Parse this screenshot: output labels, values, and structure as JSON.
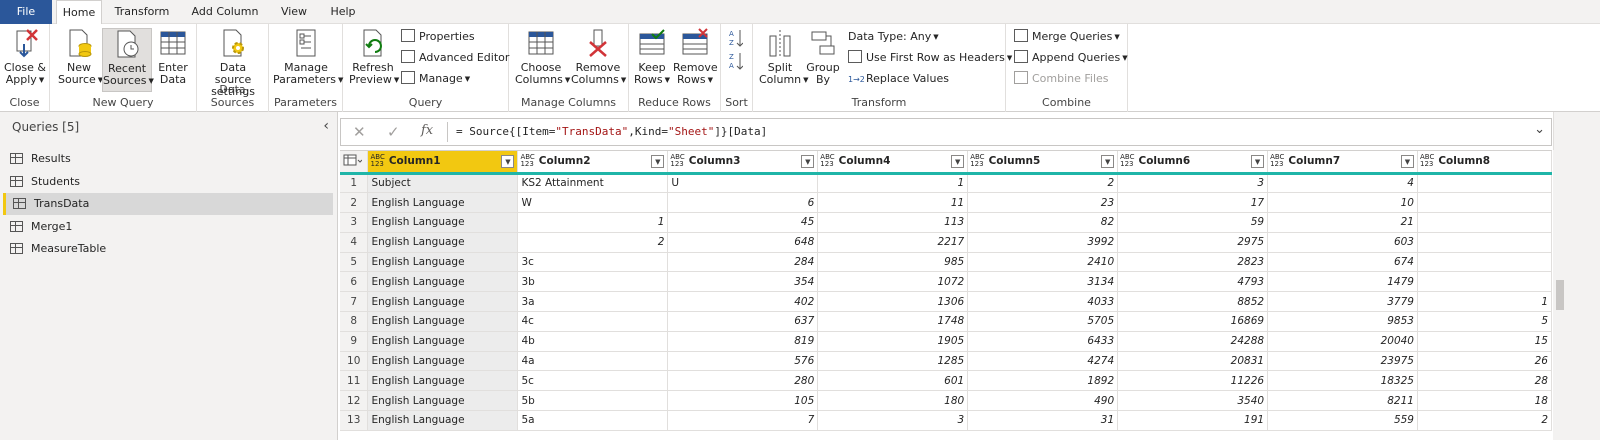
{
  "tabs": [
    "File",
    "Home",
    "Transform",
    "Add Column",
    "View",
    "Help"
  ],
  "ribbon": {
    "close": {
      "label": "Close",
      "close_apply": "Close &",
      "close_apply2": "Apply"
    },
    "new_query": {
      "label": "New Query",
      "new_source": "New",
      "new_source2": "Source",
      "recent": "Recent",
      "recent2": "Sources",
      "enter": "Enter",
      "enter2": "Data"
    },
    "data_sources": {
      "label": "Data Sources",
      "settings": "Data source",
      "settings2": "settings"
    },
    "parameters": {
      "label": "Parameters",
      "manage": "Manage",
      "manage2": "Parameters"
    },
    "query": {
      "label": "Query",
      "refresh": "Refresh",
      "refresh2": "Preview",
      "properties": "Properties",
      "advanced": "Advanced Editor",
      "manage": "Manage"
    },
    "manage_columns": {
      "label": "Manage Columns",
      "choose": "Choose",
      "choose2": "Columns",
      "remove": "Remove",
      "remove2": "Columns"
    },
    "reduce_rows": {
      "label": "Reduce Rows",
      "keep": "Keep",
      "keep2": "Rows",
      "remove": "Remove",
      "remove2": "Rows"
    },
    "sort": {
      "label": "Sort"
    },
    "transform": {
      "label": "Transform",
      "split": "Split",
      "split2": "Column",
      "group": "Group",
      "group2": "By",
      "datatype": "Data Type: Any",
      "firstrow": "Use First Row as Headers",
      "replace": "Replace Values"
    },
    "combine": {
      "label": "Combine",
      "merge": "Merge Queries",
      "append": "Append Queries",
      "files": "Combine Files"
    }
  },
  "queries": {
    "title": "Queries [5]",
    "items": [
      "Results",
      "Students",
      "TransData",
      "Merge1",
      "MeasureTable"
    ],
    "selected_index": 2
  },
  "formula": {
    "prefix": "= Source{[Item=",
    "item": "\"TransData\"",
    "mid": ",Kind=",
    "kind": "\"Sheet\"",
    "suffix": "]}[Data]"
  },
  "grid": {
    "type_label": "ABC\n123",
    "columns": [
      "Column1",
      "Column2",
      "Column3",
      "Column4",
      "Column5",
      "Column6",
      "Column7",
      "Column8"
    ],
    "rows": [
      [
        "1",
        "Subject",
        "KS2 Attainment",
        "U",
        "1",
        "2",
        "3",
        "4",
        ""
      ],
      [
        "2",
        "English Language",
        "W",
        "6",
        "11",
        "23",
        "17",
        "10",
        ""
      ],
      [
        "3",
        "English Language",
        "1",
        "45",
        "113",
        "82",
        "59",
        "21",
        ""
      ],
      [
        "4",
        "English Language",
        "2",
        "648",
        "2217",
        "3992",
        "2975",
        "603",
        ""
      ],
      [
        "5",
        "English Language",
        "3c",
        "284",
        "985",
        "2410",
        "2823",
        "674",
        ""
      ],
      [
        "6",
        "English Language",
        "3b",
        "354",
        "1072",
        "3134",
        "4793",
        "1479",
        ""
      ],
      [
        "7",
        "English Language",
        "3a",
        "402",
        "1306",
        "4033",
        "8852",
        "3779",
        "1"
      ],
      [
        "8",
        "English Language",
        "4c",
        "637",
        "1748",
        "5705",
        "16869",
        "9853",
        "5"
      ],
      [
        "9",
        "English Language",
        "4b",
        "819",
        "1905",
        "6433",
        "24288",
        "20040",
        "15"
      ],
      [
        "10",
        "English Language",
        "4a",
        "576",
        "1285",
        "4274",
        "20831",
        "23975",
        "26"
      ],
      [
        "11",
        "English Language",
        "5c",
        "280",
        "601",
        "1892",
        "11226",
        "18325",
        "28"
      ],
      [
        "12",
        "English Language",
        "5b",
        "105",
        "180",
        "490",
        "3540",
        "8211",
        "18"
      ],
      [
        "13",
        "English Language",
        "5a",
        "7",
        "3",
        "31",
        "191",
        "559",
        "2"
      ]
    ]
  }
}
